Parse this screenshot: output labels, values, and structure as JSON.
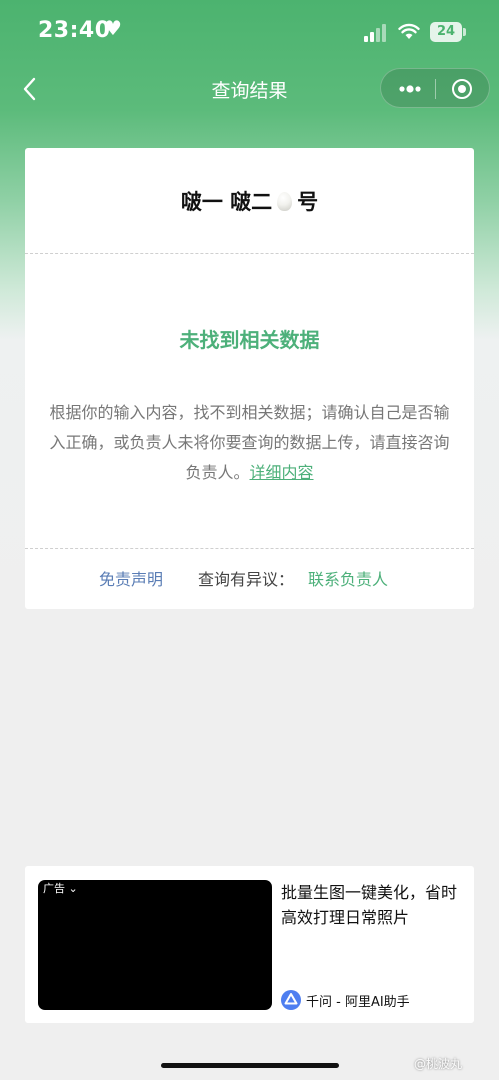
{
  "status_bar": {
    "time": "23:40",
    "battery": "24"
  },
  "navbar": {
    "title": "查询结果"
  },
  "result": {
    "title_part1": "啵一 啵二",
    "title_part2": "号",
    "not_found": "未找到相关数据",
    "description": "根据你的输入内容，找不到相关数据；请确认自己是否输入正确，或负责人未将你要查询的数据上传，请直接咨询负责人。",
    "details_link": "详细内容",
    "disclaimer": "免责声明",
    "objection_label": "查询有异议：",
    "contact_link": "联系负责人"
  },
  "ad": {
    "tag": "广告",
    "text": "批量生图一键美化，省时高效打理日常照片",
    "brand": "千问 - 阿里AI助手"
  },
  "watermark": "@桃波丸"
}
